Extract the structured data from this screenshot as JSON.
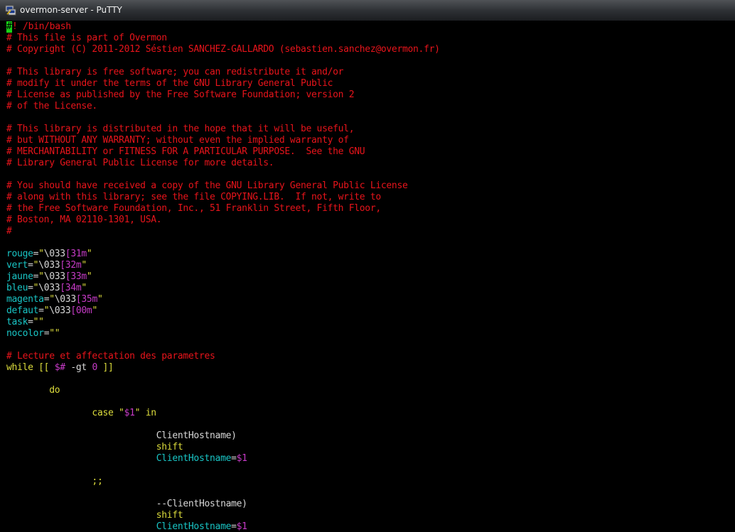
{
  "window": {
    "title": "overmon-server - PuTTY",
    "icon": "putty-icon"
  },
  "terminal": {
    "header": {
      "shebang_cursor": "#",
      "shebang_rest": "! /bin/bash",
      "comments": [
        "# This file is part of Overmon",
        "# Copyright (C) 2011-2012 Séstien SANCHEZ-GALLARDO (sebastien.sanchez@overmon.fr)",
        "",
        "# This library is free software; you can redistribute it and/or",
        "# modify it under the terms of the GNU Library General Public",
        "# License as published by the Free Software Foundation; version 2",
        "# of the License.",
        "",
        "# This library is distributed in the hope that it will be useful,",
        "# but WITHOUT ANY WARRANTY; without even the implied warranty of",
        "# MERCHANTABILITY or FITNESS FOR A PARTICULAR PURPOSE.  See the GNU",
        "# Library General Public License for more details.",
        "",
        "# You should have received a copy of the GNU Library General Public License",
        "# along with this library; see the file COPYING.LIB.  If not, write to",
        "# the Free Software Foundation, Inc., 51 Franklin Street, Fifth Floor,",
        "# Boston, MA 02110-1301, USA.",
        "#"
      ]
    },
    "vars": [
      {
        "name": "rouge",
        "esc": "\\033",
        "code": "[31m"
      },
      {
        "name": "vert",
        "esc": "\\033",
        "code": "[32m"
      },
      {
        "name": "jaune",
        "esc": "\\033",
        "code": "[33m"
      },
      {
        "name": "bleu",
        "esc": "\\033",
        "code": "[34m"
      },
      {
        "name": "magenta",
        "esc": "\\033",
        "code": "[35m"
      },
      {
        "name": "defaut",
        "esc": "\\033",
        "code": "[00m"
      },
      {
        "name": "task",
        "esc": "",
        "code": ""
      },
      {
        "name": "nocolor",
        "esc": "",
        "code": ""
      }
    ],
    "lecture_comment": "# Lecture et affectation des parametres",
    "while": {
      "kw": "while [[ ",
      "var": "$#",
      "op": " -gt ",
      "num": "0",
      "end": " ]]"
    },
    "do_kw": "do",
    "case": {
      "kw": "case ",
      "q1": "\"",
      "var": "$1",
      "q2": "\"",
      "in": " in"
    },
    "block1": {
      "label": "ClientHostname)",
      "shift": "shift",
      "assign_name": "ClientHostname",
      "eq": "=",
      "assign_val": "$1"
    },
    "sep": ";;",
    "block2": {
      "label": "--ClientHostname)",
      "shift": "shift",
      "assign_name": "ClientHostname",
      "eq": "=",
      "assign_val": "$1"
    }
  }
}
